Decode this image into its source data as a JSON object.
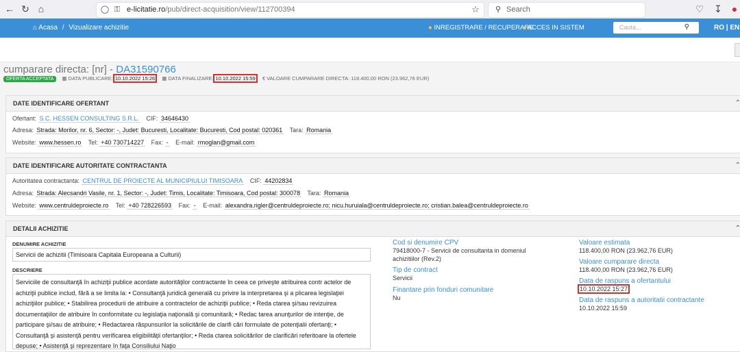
{
  "browser": {
    "url_domain": "e-licitatie.ro",
    "url_path": "/pub/direct-acquisition/view/112700394",
    "search_placeholder": "Search"
  },
  "header": {
    "home_label": "Acasa",
    "separator": "/",
    "breadcrumb_current": "Vizualizare achizitie",
    "register_label": "INREGISTRARE / RECUPERARE",
    "login_label": "ACCES IN SISTEM",
    "search_placeholder": "Cauta...",
    "lang": "RO | EN"
  },
  "title": {
    "prefix": "cumparare directa: [nr] - ",
    "code": "DA31590766"
  },
  "meta": {
    "badge": "OFERTA ACCEPTATA",
    "pub_label": "DATA PUBLICARE:",
    "pub_value": "10.10.2022 15:26",
    "fin_label": "DATA FINALIZARE:",
    "fin_value": "10.10.2022 15:59",
    "value_label": "VALOARE CUMPARARE DIRECTA: 118.400,00  RON (23.962,76  EUR)"
  },
  "offerer": {
    "title": "DATE IDENTIFICARE OFERTANT",
    "ofertant_label": "Ofertant:",
    "ofertant": "S.C. HESSEN CONSULTING S.R.L.",
    "cif_label": "CIF:",
    "cif": "34646430",
    "address_label": "Adresa:",
    "address": "Strada: Morilor, nr. 6, Sector: -, Judet: Bucuresti, Localitate: Bucuresti, Cod postal: 020361",
    "country_label": "Tara:",
    "country": "Romania",
    "website_label": "Website:",
    "website": "www.hessen.ro",
    "tel_label": "Tel:",
    "tel": "+40 730714227",
    "fax_label": "Fax:",
    "fax": "-",
    "email_label": "E-mail:",
    "email": "rmoglan@gmail.com"
  },
  "authority": {
    "title": "DATE IDENTIFICARE AUTORITATE CONTRACTANTA",
    "name_label": "Autoritatea contractanta:",
    "name": "CENTRUL DE PROIECTE AL MUNICIPIULUI TIMISOARA",
    "cif_label": "CIF:",
    "cif": "44202834",
    "address_label": "Adresa:",
    "address": "Strada: Alecsandri Vasile, nr. 1, Sector: -, Judet: Timis, Localitate: Timisoara, Cod postal: 300078",
    "country_label": "Tara:",
    "country": "Romania",
    "website_label": "Website:",
    "website": "www.centruldeproiecte.ro",
    "tel_label": "Tel:",
    "tel": "+40 728226593",
    "fax_label": "Fax:",
    "fax": "-",
    "email_label": "E-mail:",
    "email": "alexandra.rigler@centruldeproiecte.ro; nicu.huruiala@centruldeproiecte.ro; cristian.balea@centruldeproiecte.ro"
  },
  "details": {
    "title": "DETALII ACHIZITIE",
    "name_label": "DENUMIRE ACHIZITIE",
    "name": "Servicii de achizitii (Timisoara Capitala Europeana a Culturii)",
    "desc_label": "DESCRIERE",
    "desc": "Serviciile de consultanţă în achiziţii publice acordate autorităţilor contractante în ceea ce priveşte atribuirea contr actelor de achiziţii publice includ, fără a se limita la: • Consultanţă juridică generală cu privire la interpretarea şi a plicarea legislaţiei achiziţiilor publice; • Stabilirea procedurii de atribuire a contractelor de achiziţii publice; • Reda ctarea şi/sau revizuirea documentaţiilor de atribuire în conformitate cu legislaţia naţională şi comunitară; • Redac tarea anunţurilor de intenţie, de participare şi/sau de atribuire; • Redactarea răspunsurilor la solicitările de clarifi cări formulate de potenţialii ofertanţi; • Consultanţă şi asistenţă pentru verificarea eligibilităţii ofertanţilor; • Reda ctarea solicitărilor de clarificări referitoare la ofertele depuse; • Asistenţă şi reprezentare în faţa Consiliului Naţio",
    "cpv_label": "Cod si denumire CPV",
    "cpv_line1": "79418000-7 - Servicii de consultanta in domeniul",
    "cpv_line2": "achizitiilor (Rev.2)",
    "contract_label": "Tip de contract",
    "contract": "Servicii",
    "funds_label": "Finantare prin fonduri comunitare",
    "funds": "Nu",
    "est_label": "Valoare estimata",
    "est": "118.400,00  RON (23.962,76  EUR)",
    "dir_label": "Valoare cumparare directa",
    "dir": "118.400,00  RON (23.962,76  EUR)",
    "resp_label": "Data de raspuns a ofertantului",
    "resp": "10.10.2022 15:27",
    "auth_resp_label": "Data de raspuns a autoritatii contractante",
    "auth_resp": "10.10.2022 15:59"
  }
}
